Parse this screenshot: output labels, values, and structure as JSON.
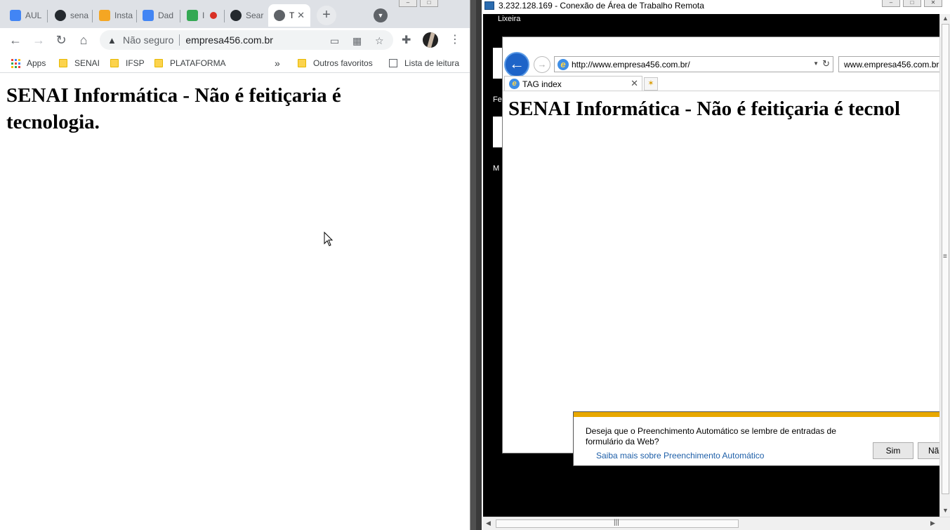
{
  "chrome": {
    "tabs": [
      {
        "label": "AUL",
        "color": "#4285f4"
      },
      {
        "label": "sena",
        "color": "#24292e"
      },
      {
        "label": "Insta",
        "color": "#f4a623"
      },
      {
        "label": "Dad",
        "color": "#4285f4"
      },
      {
        "label": "I",
        "color": "#34a853"
      },
      {
        "label": "Sear",
        "color": "#24292e"
      },
      {
        "label": "T",
        "color": "#5f6368"
      }
    ],
    "new_tab_symbol": "+",
    "omnibox": {
      "security_text": "Não seguro",
      "url": "empresa456.com.br"
    },
    "bookmarks": {
      "apps": "Apps",
      "items": [
        "SENAI",
        "IFSP",
        "PLATAFORMA"
      ],
      "more": "»",
      "other": "Outros favoritos",
      "reading_list": "Lista de leitura"
    },
    "page_heading": "SENAI Informática - Não é feitiçaria é tecnologia."
  },
  "rdp": {
    "title": "3.232.128.169 - Conexão de Área de Trabalho Remota",
    "desktop_labels": {
      "recycle": "Lixeira",
      "fe": "Fe",
      "m": "M"
    },
    "ie": {
      "address_url": "http://www.empresa456.com.br/",
      "second_address": "www.empresa456.com.br",
      "tab_title": "TAG index",
      "page_heading": "SENAI Informática - Não é feitiçaria é tecnol"
    },
    "autocomplete": {
      "message": "Deseja que o Preenchimento Automático se lembre de entradas de formulário da Web?",
      "link": "Saiba mais sobre Preenchimento Automático",
      "yes": "Sim",
      "no": "Nã"
    }
  }
}
